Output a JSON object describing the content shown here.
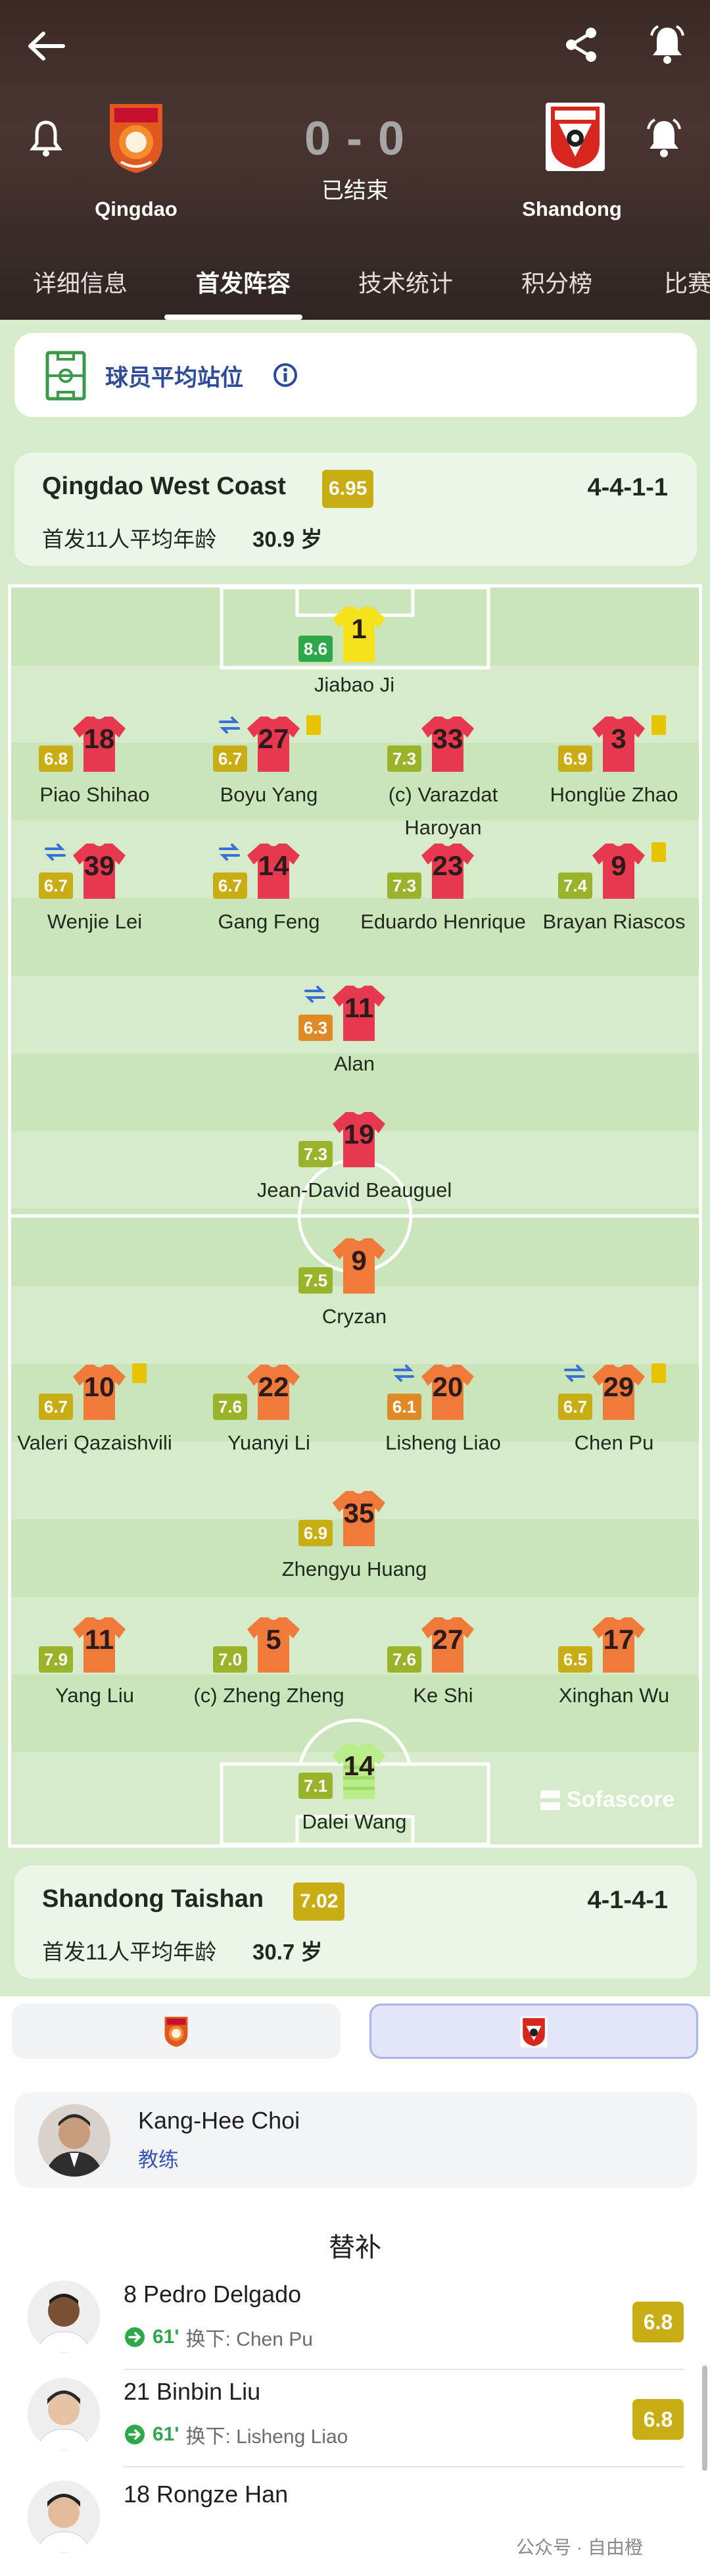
{
  "header": {
    "home_team": "Qingdao",
    "away_team": "Shandong",
    "score": "0 - 0",
    "status": "已结束"
  },
  "tabs": [
    "详细信息",
    "首发阵容",
    "技术统计",
    "积分榜",
    "比赛"
  ],
  "active_tab": "首发阵容",
  "avg_positions": {
    "label": "球员平均站位"
  },
  "home_card": {
    "name": "Qingdao West Coast",
    "rating": "6.95",
    "formation": "4-4-1-1",
    "age_label": "首发11人平均年龄",
    "age": "30.9 岁"
  },
  "away_card": {
    "name": "Shandong Taishan",
    "rating": "7.02",
    "formation": "4-1-4-1",
    "age_label": "首发11人平均年龄",
    "age": "30.7 岁"
  },
  "home_players": [
    {
      "num": "1",
      "name": "Jiabao Ji",
      "rating": "8.6",
      "rating_color": "#2ea84a"
    },
    {
      "num": "18",
      "name": "Piao Shihao",
      "rating": "6.8",
      "rating_color": "#c9ad14"
    },
    {
      "num": "27",
      "name": "Boyu Yang",
      "rating": "6.7",
      "rating_color": "#c9ad14"
    },
    {
      "num": "33",
      "name": "(c) Varazdat Haroyan",
      "rating": "7.3",
      "rating_color": "#99b32a"
    },
    {
      "num": "3",
      "name": "Honglüe Zhao",
      "rating": "6.9",
      "rating_color": "#c9ad14"
    },
    {
      "num": "39",
      "name": "Wenjie Lei",
      "rating": "6.7",
      "rating_color": "#c9ad14"
    },
    {
      "num": "14",
      "name": "Gang Feng",
      "rating": "6.7",
      "rating_color": "#c9ad14"
    },
    {
      "num": "23",
      "name": "Eduardo Henrique",
      "rating": "7.3",
      "rating_color": "#99b32a"
    },
    {
      "num": "9",
      "name": "Brayan Riascos",
      "rating": "7.4",
      "rating_color": "#99b32a"
    },
    {
      "num": "11",
      "name": "Alan",
      "rating": "6.3",
      "rating_color": "#e08a26"
    },
    {
      "num": "19",
      "name": "Jean-David Beauguel",
      "rating": "7.3",
      "rating_color": "#99b32a"
    }
  ],
  "away_players": [
    {
      "num": "9",
      "name": "Cryzan",
      "rating": "7.5",
      "rating_color": "#99b32a"
    },
    {
      "num": "10",
      "name": "Valeri Qazaishvili",
      "rating": "6.7",
      "rating_color": "#c9ad14"
    },
    {
      "num": "22",
      "name": "Yuanyi Li",
      "rating": "7.6",
      "rating_color": "#99b32a"
    },
    {
      "num": "20",
      "name": "Lisheng Liao",
      "rating": "6.1",
      "rating_color": "#e08a26"
    },
    {
      "num": "29",
      "name": "Chen Pu",
      "rating": "6.7",
      "rating_color": "#c9ad14"
    },
    {
      "num": "35",
      "name": "Zhengyu Huang",
      "rating": "6.9",
      "rating_color": "#c9ad14"
    },
    {
      "num": "11",
      "name": "Yang Liu",
      "rating": "7.9",
      "rating_color": "#99b32a"
    },
    {
      "num": "5",
      "name": "(c) Zheng Zheng",
      "rating": "7.0",
      "rating_color": "#99b32a"
    },
    {
      "num": "27",
      "name": "Ke Shi",
      "rating": "7.6",
      "rating_color": "#99b32a"
    },
    {
      "num": "17",
      "name": "Xinghan Wu",
      "rating": "6.5",
      "rating_color": "#c9ad14"
    },
    {
      "num": "14",
      "name": "Dalei Wang",
      "rating": "7.1",
      "rating_color": "#99b32a"
    }
  ],
  "branding": "Sofascore",
  "coach": {
    "name": "Kang-Hee Choi",
    "role": "教练"
  },
  "subs_title": "替补",
  "subs": [
    {
      "name": "8 Pedro Delgado",
      "minute": "61'",
      "info": "换下: Chen Pu",
      "rating": "6.8"
    },
    {
      "name": "21 Binbin Liu",
      "minute": "61'",
      "info": "换下: Lisheng Liao",
      "rating": "6.8"
    },
    {
      "name": "18 Rongze Han",
      "minute": "",
      "info": "",
      "rating": ""
    }
  ],
  "watermark": "公众号 · 自由橙",
  "colors": {
    "home_shirt": "#e8384f",
    "away_shirt": "#f07a3a",
    "gk_home": "#f5e21a",
    "gk_away": "#b9ee8a",
    "pitch": "#d6ebc9",
    "stripe": "#cbe5bb"
  }
}
